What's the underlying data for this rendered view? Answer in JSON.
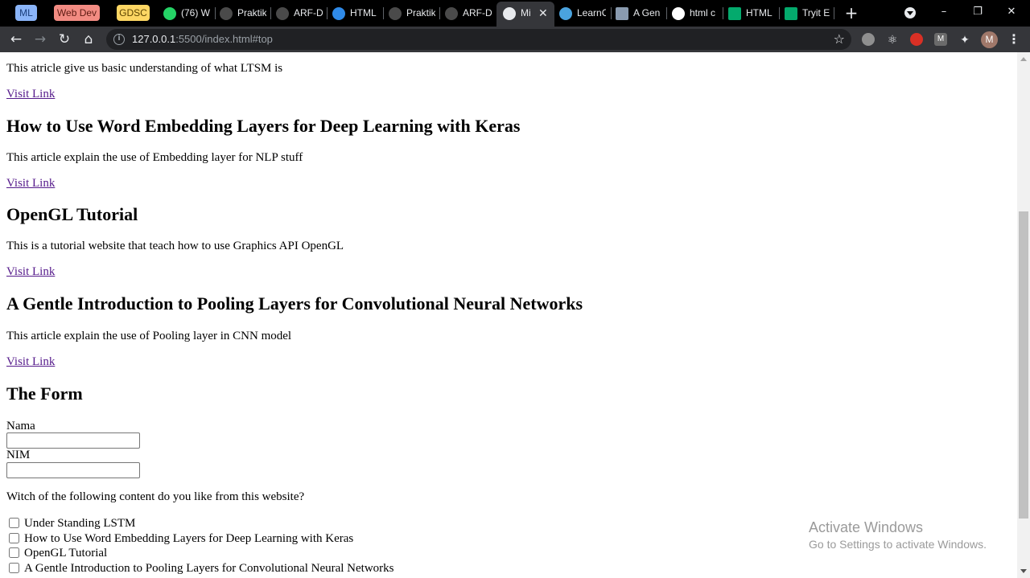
{
  "browser": {
    "bookmarks": [
      {
        "label": "ML",
        "color": "#8ab4f8"
      },
      {
        "label": "Web Dev",
        "color": "#f28b82"
      },
      {
        "label": "GDSC",
        "color": "#fdd663"
      }
    ],
    "tabs": [
      {
        "title": "(76) W",
        "icon": "whatsapp-icon"
      },
      {
        "title": "Praktik",
        "icon": "github-icon"
      },
      {
        "title": "ARF-D",
        "icon": "github-icon"
      },
      {
        "title": "HTML",
        "icon": "edge-icon"
      },
      {
        "title": "Praktik",
        "icon": "github-icon"
      },
      {
        "title": "ARF-D",
        "icon": "github-icon"
      },
      {
        "title": "Mi",
        "icon": "globe-icon",
        "active": true
      },
      {
        "title": "LearnC",
        "icon": "learncpp-icon"
      },
      {
        "title": "A Gen",
        "icon": "page-thumb-icon"
      },
      {
        "title": "html c",
        "icon": "google-icon"
      },
      {
        "title": "HTML",
        "icon": "w3schools-icon"
      },
      {
        "title": "Tryit E",
        "icon": "w3schools-icon"
      }
    ],
    "new_tab": "+",
    "close_glyph": "✕",
    "url_host": "127.0.0.1",
    "url_rest": ":5500/index.html#top",
    "avatar_letter": "M",
    "extensions": [
      "extension-icon-1",
      "react-devtools-icon",
      "extension-icon-3",
      "m-extension-icon",
      "puzzle-icon"
    ]
  },
  "page": {
    "intro_text": "This atricle give us basic understanding of what LTSM is",
    "link_label": "Visit Link",
    "articles": [
      {
        "title": "How to Use Word Embedding Layers for Deep Learning with Keras",
        "desc": "This article explain the use of Embedding layer for NLP stuff",
        "link": "Visit Link"
      },
      {
        "title": "OpenGL Tutorial",
        "desc": "This is a tutorial website that teach how to use Graphics API OpenGL",
        "link": "Visit Link"
      },
      {
        "title": "A Gentle Introduction to Pooling Layers for Convolutional Neural Networks",
        "desc": "This article explain the use of Pooling layer in CNN model",
        "link": "Visit Link"
      }
    ],
    "form": {
      "heading": "The Form",
      "nama_label": "Nama",
      "nama_value": "",
      "nim_label": "NIM",
      "nim_value": "",
      "question": "Witch of the following content do you like from this website?",
      "options": [
        {
          "label": "Under Standing LSTM",
          "checked": false
        },
        {
          "label": "How to Use Word Embedding Layers for Deep Learning with Keras",
          "checked": false
        },
        {
          "label": "OpenGL Tutorial",
          "checked": false
        },
        {
          "label": "A Gentle Introduction to Pooling Layers for Convolutional Neural Networks",
          "checked": false
        }
      ]
    }
  },
  "os": {
    "watermark_title": "Activate Windows",
    "watermark_sub": "Go to Settings to activate Windows."
  }
}
